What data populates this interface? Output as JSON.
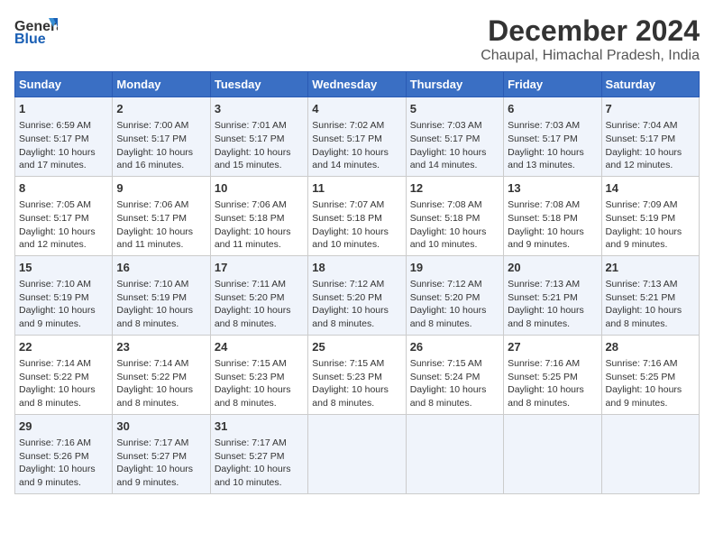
{
  "header": {
    "logo_line1": "General",
    "logo_line2": "Blue",
    "title": "December 2024",
    "subtitle": "Chaupal, Himachal Pradesh, India"
  },
  "columns": [
    "Sunday",
    "Monday",
    "Tuesday",
    "Wednesday",
    "Thursday",
    "Friday",
    "Saturday"
  ],
  "rows": [
    [
      {
        "day": "1",
        "sunrise": "6:59 AM",
        "sunset": "5:17 PM",
        "daylight": "10 hours and 17 minutes."
      },
      {
        "day": "2",
        "sunrise": "7:00 AM",
        "sunset": "5:17 PM",
        "daylight": "10 hours and 16 minutes."
      },
      {
        "day": "3",
        "sunrise": "7:01 AM",
        "sunset": "5:17 PM",
        "daylight": "10 hours and 15 minutes."
      },
      {
        "day": "4",
        "sunrise": "7:02 AM",
        "sunset": "5:17 PM",
        "daylight": "10 hours and 14 minutes."
      },
      {
        "day": "5",
        "sunrise": "7:03 AM",
        "sunset": "5:17 PM",
        "daylight": "10 hours and 14 minutes."
      },
      {
        "day": "6",
        "sunrise": "7:03 AM",
        "sunset": "5:17 PM",
        "daylight": "10 hours and 13 minutes."
      },
      {
        "day": "7",
        "sunrise": "7:04 AM",
        "sunset": "5:17 PM",
        "daylight": "10 hours and 12 minutes."
      }
    ],
    [
      {
        "day": "8",
        "sunrise": "7:05 AM",
        "sunset": "5:17 PM",
        "daylight": "10 hours and 12 minutes."
      },
      {
        "day": "9",
        "sunrise": "7:06 AM",
        "sunset": "5:17 PM",
        "daylight": "10 hours and 11 minutes."
      },
      {
        "day": "10",
        "sunrise": "7:06 AM",
        "sunset": "5:18 PM",
        "daylight": "10 hours and 11 minutes."
      },
      {
        "day": "11",
        "sunrise": "7:07 AM",
        "sunset": "5:18 PM",
        "daylight": "10 hours and 10 minutes."
      },
      {
        "day": "12",
        "sunrise": "7:08 AM",
        "sunset": "5:18 PM",
        "daylight": "10 hours and 10 minutes."
      },
      {
        "day": "13",
        "sunrise": "7:08 AM",
        "sunset": "5:18 PM",
        "daylight": "10 hours and 9 minutes."
      },
      {
        "day": "14",
        "sunrise": "7:09 AM",
        "sunset": "5:19 PM",
        "daylight": "10 hours and 9 minutes."
      }
    ],
    [
      {
        "day": "15",
        "sunrise": "7:10 AM",
        "sunset": "5:19 PM",
        "daylight": "10 hours and 9 minutes."
      },
      {
        "day": "16",
        "sunrise": "7:10 AM",
        "sunset": "5:19 PM",
        "daylight": "10 hours and 8 minutes."
      },
      {
        "day": "17",
        "sunrise": "7:11 AM",
        "sunset": "5:20 PM",
        "daylight": "10 hours and 8 minutes."
      },
      {
        "day": "18",
        "sunrise": "7:12 AM",
        "sunset": "5:20 PM",
        "daylight": "10 hours and 8 minutes."
      },
      {
        "day": "19",
        "sunrise": "7:12 AM",
        "sunset": "5:20 PM",
        "daylight": "10 hours and 8 minutes."
      },
      {
        "day": "20",
        "sunrise": "7:13 AM",
        "sunset": "5:21 PM",
        "daylight": "10 hours and 8 minutes."
      },
      {
        "day": "21",
        "sunrise": "7:13 AM",
        "sunset": "5:21 PM",
        "daylight": "10 hours and 8 minutes."
      }
    ],
    [
      {
        "day": "22",
        "sunrise": "7:14 AM",
        "sunset": "5:22 PM",
        "daylight": "10 hours and 8 minutes."
      },
      {
        "day": "23",
        "sunrise": "7:14 AM",
        "sunset": "5:22 PM",
        "daylight": "10 hours and 8 minutes."
      },
      {
        "day": "24",
        "sunrise": "7:15 AM",
        "sunset": "5:23 PM",
        "daylight": "10 hours and 8 minutes."
      },
      {
        "day": "25",
        "sunrise": "7:15 AM",
        "sunset": "5:23 PM",
        "daylight": "10 hours and 8 minutes."
      },
      {
        "day": "26",
        "sunrise": "7:15 AM",
        "sunset": "5:24 PM",
        "daylight": "10 hours and 8 minutes."
      },
      {
        "day": "27",
        "sunrise": "7:16 AM",
        "sunset": "5:25 PM",
        "daylight": "10 hours and 8 minutes."
      },
      {
        "day": "28",
        "sunrise": "7:16 AM",
        "sunset": "5:25 PM",
        "daylight": "10 hours and 9 minutes."
      }
    ],
    [
      {
        "day": "29",
        "sunrise": "7:16 AM",
        "sunset": "5:26 PM",
        "daylight": "10 hours and 9 minutes."
      },
      {
        "day": "30",
        "sunrise": "7:17 AM",
        "sunset": "5:27 PM",
        "daylight": "10 hours and 9 minutes."
      },
      {
        "day": "31",
        "sunrise": "7:17 AM",
        "sunset": "5:27 PM",
        "daylight": "10 hours and 10 minutes."
      },
      null,
      null,
      null,
      null
    ]
  ]
}
